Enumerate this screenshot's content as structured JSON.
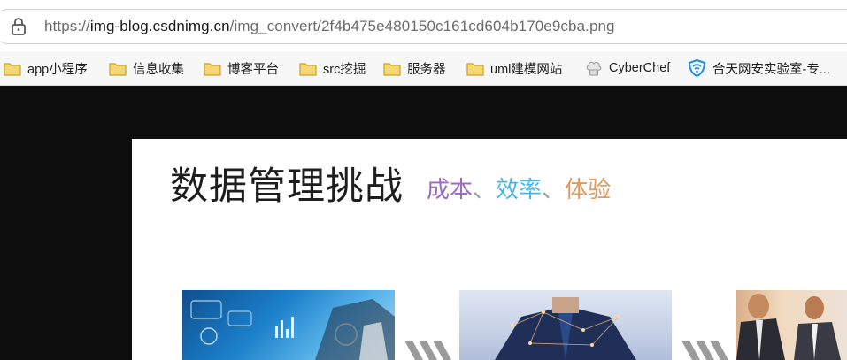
{
  "address_bar": {
    "url_scheme": "https://",
    "url_host": "img-blog.csdnimg.cn",
    "url_path": "/img_convert/2f4b475e480150c161cd604b170e9cba.png",
    "lock_icon": "lock-icon"
  },
  "bookmarks": [
    {
      "label": "app小程序",
      "icon": "folder-icon"
    },
    {
      "label": "信息收集",
      "icon": "folder-icon"
    },
    {
      "label": "博客平台",
      "icon": "folder-icon"
    },
    {
      "label": "src挖掘",
      "icon": "folder-icon"
    },
    {
      "label": "服务器",
      "icon": "folder-icon"
    },
    {
      "label": "uml建模网站",
      "icon": "folder-icon"
    },
    {
      "label": "CyberChef",
      "icon": "chef-hat-icon"
    },
    {
      "label": "合天网安实验室-专...",
      "icon": "shield-wifi-icon"
    }
  ],
  "slide": {
    "title": "数据管理挑战",
    "subtitle_parts": [
      "成本",
      "、",
      "效率",
      "、",
      "体验"
    ]
  },
  "colors": {
    "subtitle_cost": "#9d6bc4",
    "subtitle_efficiency": "#4ab6e6",
    "subtitle_experience": "#e09a5f",
    "folder_fill": "#f7d774",
    "folder_stroke": "#c9a227",
    "page_background": "#0e0e0e"
  }
}
